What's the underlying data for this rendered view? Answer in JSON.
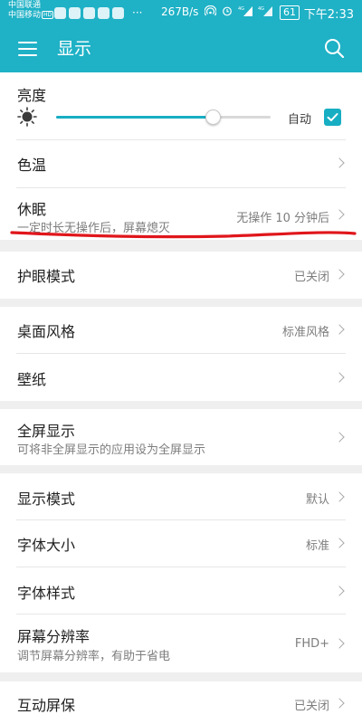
{
  "status_bar": {
    "carrier_1": "中国联通",
    "carrier_2": "中国移动",
    "volte_badge": "HD",
    "more": "···",
    "net_speed": "267B/s",
    "icons": [
      "hotspot-icon",
      "alarm-icon",
      "signal-4g-icon",
      "signal-4g-icon"
    ],
    "signal_1_label": "4G",
    "signal_2_label": "4G",
    "battery": "61",
    "time": "下午2:33"
  },
  "app_bar": {
    "title": "显示",
    "menu_icon": "menu-icon",
    "search_icon": "search-icon"
  },
  "brightness": {
    "title": "亮度",
    "level": 0.73,
    "auto_label": "自动",
    "auto_checked": true
  },
  "settings": {
    "color_temp": {
      "title": "色温"
    },
    "sleep": {
      "title": "休眠",
      "subtitle": "一定时长无操作后，屏幕熄灭",
      "value": "无操作 10 分钟后"
    },
    "eye_comfort": {
      "title": "护眼模式",
      "value": "已关闭"
    },
    "desktop_style": {
      "title": "桌面风格",
      "value": "标准风格"
    },
    "wallpaper": {
      "title": "壁纸"
    },
    "fullscreen": {
      "title": "全屏显示",
      "subtitle": "可将非全屏显示的应用设为全屏显示"
    },
    "display_mode": {
      "title": "显示模式",
      "value": "默认"
    },
    "font_size": {
      "title": "字体大小",
      "value": "标准"
    },
    "font_style": {
      "title": "字体样式"
    },
    "resolution": {
      "title": "屏幕分辨率",
      "subtitle": "调节屏幕分辨率，有助于省电",
      "value": "FHD+"
    },
    "screensaver": {
      "title": "互动屏保",
      "value": "已关闭"
    }
  },
  "colors": {
    "accent": "#1fb1c6",
    "annotation": "#e0161b"
  }
}
